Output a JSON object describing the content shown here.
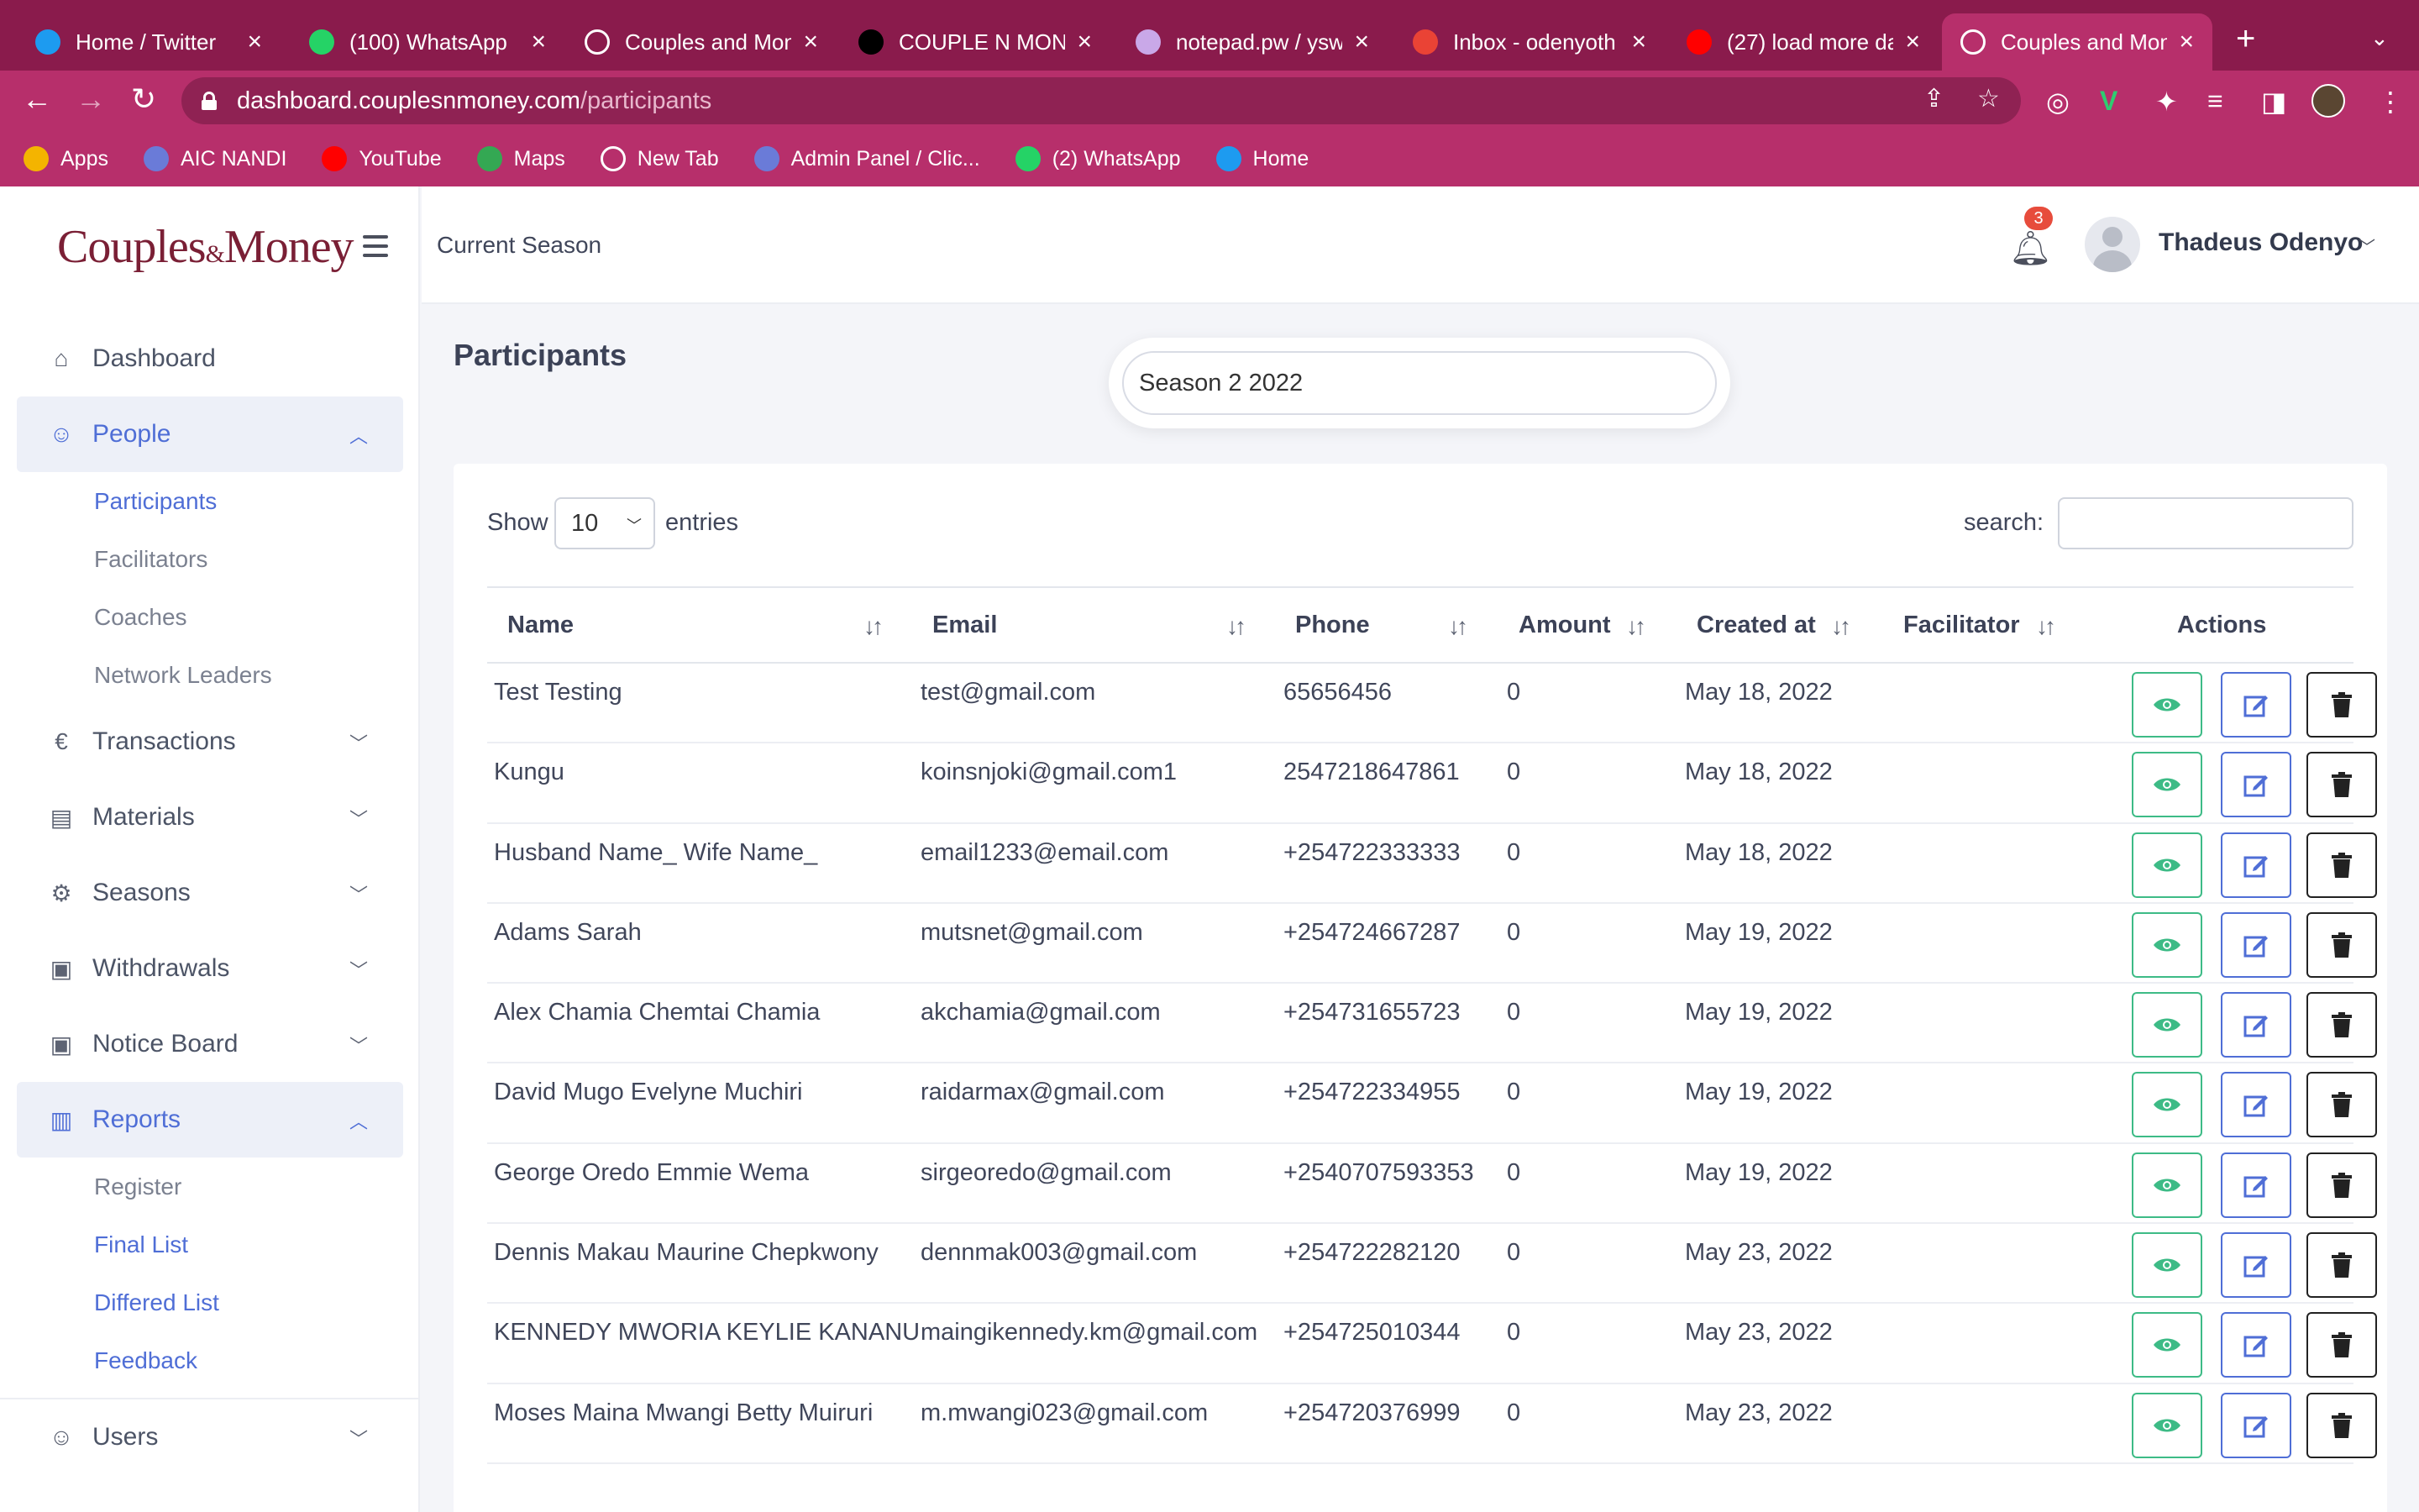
{
  "browser": {
    "tabs": [
      {
        "title": "Home / Twitter",
        "icon": "twitter-icon",
        "color": "#1d9bf0"
      },
      {
        "title": "(100) WhatsApp",
        "icon": "whatsapp-icon",
        "color": "#25d366"
      },
      {
        "title": "Couples and Mon",
        "icon": "globe-icon",
        "color": "#ffffff"
      },
      {
        "title": "COUPLE N MONE",
        "icon": "bowtie-icon",
        "color": "#000000"
      },
      {
        "title": "notepad.pw / ysw",
        "icon": "notepad-icon",
        "color": "#c9a8e8"
      },
      {
        "title": "Inbox - odenyoth",
        "icon": "gmail-icon",
        "color": "#ea4335"
      },
      {
        "title": "(27) load more da",
        "icon": "youtube-icon",
        "color": "#ff0000"
      },
      {
        "title": "Couples and Mon",
        "icon": "globe-icon",
        "color": "#ffffff"
      }
    ],
    "url_host": "dashboard.couplesnmoney.com",
    "url_path": "/participants",
    "bookmarks": [
      {
        "label": "Apps",
        "icon": "apps-grid-icon",
        "color": "#f4b400"
      },
      {
        "label": "AIC NANDI",
        "icon": "globe-icon",
        "color": "#6a7bd8"
      },
      {
        "label": "YouTube",
        "icon": "youtube-icon",
        "color": "#ff0000"
      },
      {
        "label": "Maps",
        "icon": "maps-icon",
        "color": "#34a853"
      },
      {
        "label": "New Tab",
        "icon": "globe-icon",
        "color": "#ffffff"
      },
      {
        "label": "Admin Panel / Clic...",
        "icon": "globe-icon",
        "color": "#6a7bd8"
      },
      {
        "label": "(2) WhatsApp",
        "icon": "whatsapp-icon",
        "color": "#25d366"
      },
      {
        "label": "Home",
        "icon": "twitter-icon",
        "color": "#1d9bf0"
      }
    ]
  },
  "sidebar": {
    "logo_main": "Couples",
    "logo_amp": "&",
    "logo_end": "Money",
    "items": {
      "dashboard": "Dashboard",
      "people": "People",
      "transactions": "Transactions",
      "materials": "Materials",
      "seasons": "Seasons",
      "withdrawals": "Withdrawals",
      "notice_board": "Notice Board",
      "reports": "Reports",
      "users": "Users"
    },
    "people_sub": [
      "Participants",
      "Facilitators",
      "Coaches",
      "Network Leaders"
    ],
    "reports_sub": [
      "Register",
      "Final List",
      "Differed List",
      "Feedback"
    ]
  },
  "topbar": {
    "title": "Current Season",
    "notification_count": "3",
    "user_name": "Thadeus Odenyo"
  },
  "page": {
    "title": "Participants",
    "season": "Season 2 2022",
    "show_label": "Show",
    "entries_value": "10",
    "entries_label": "entries",
    "search_label": "search:"
  },
  "table": {
    "columns": [
      "Name",
      "Email",
      "Phone",
      "Amount",
      "Created at",
      "Facilitator",
      "Actions"
    ],
    "rows": [
      {
        "name": "Test Testing",
        "email": "test@gmail.com",
        "phone": "65656456",
        "amount": "0",
        "created": "May 18, 2022",
        "facilitator": ""
      },
      {
        "name": "Kungu",
        "email": "koinsnjoki@gmail.com1",
        "phone": "2547218647861",
        "amount": "0",
        "created": "May 18, 2022",
        "facilitator": ""
      },
      {
        "name": "Husband Name_ Wife Name_",
        "email": "email1233@email.com",
        "phone": "+254722333333",
        "amount": "0",
        "created": "May 18, 2022",
        "facilitator": ""
      },
      {
        "name": "Adams Sarah",
        "email": "mutsnet@gmail.com",
        "phone": "+254724667287",
        "amount": "0",
        "created": "May 19, 2022",
        "facilitator": ""
      },
      {
        "name": "Alex Chamia Chemtai Chamia",
        "email": "akchamia@gmail.com",
        "phone": "+254731655723",
        "amount": "0",
        "created": "May 19, 2022",
        "facilitator": ""
      },
      {
        "name": "David Mugo Evelyne Muchiri",
        "email": "raidarmax@gmail.com",
        "phone": "+254722334955",
        "amount": "0",
        "created": "May 19, 2022",
        "facilitator": ""
      },
      {
        "name": "George Oredo Emmie Wema",
        "email": "sirgeoredo@gmail.com",
        "phone": "+2540707593353",
        "amount": "0",
        "created": "May 19, 2022",
        "facilitator": ""
      },
      {
        "name": "Dennis Makau Maurine Chepkwony",
        "email": "dennmak003@gmail.com",
        "phone": "+254722282120",
        "amount": "0",
        "created": "May 23, 2022",
        "facilitator": ""
      },
      {
        "name": "KENNEDY MWORIA KEYLIE KANANU",
        "email": "maingikennedy.km@gmail.com",
        "phone": "+254725010344",
        "amount": "0",
        "created": "May 23, 2022",
        "facilitator": ""
      },
      {
        "name": "Moses Maina Mwangi Betty Muiruri",
        "email": "m.mwangi023@gmail.com",
        "phone": "+254720376999",
        "amount": "0",
        "created": "May 23, 2022",
        "facilitator": ""
      }
    ]
  },
  "colors": {
    "browser_frame": "#8a1b4c",
    "browser_toolbar": "#b72f6b",
    "accent": "#4f6ed6",
    "view": "#3dbb86",
    "delete": "#222222",
    "badge": "#e74c3c"
  }
}
